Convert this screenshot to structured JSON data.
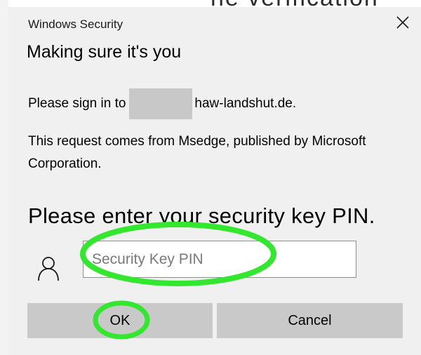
{
  "background": {
    "partial_text": "ne verification"
  },
  "dialog": {
    "label": "Windows Security",
    "title": "Making sure it's you",
    "signin_prefix": "Please sign in to",
    "signin_domain": "haw-landshut.de.",
    "request_text": "This request comes from Msedge, published by Microsoft Corporation.",
    "pin_prompt": "Please enter your security key PIN.",
    "pin_input": {
      "placeholder": "Security Key PIN",
      "value": ""
    },
    "ok_label": "OK",
    "cancel_label": "Cancel",
    "close_icon": "close-icon",
    "user_icon": "user-icon"
  },
  "annotations": {
    "color": "#33e62e",
    "targets": [
      "pin-input",
      "ok-button"
    ]
  }
}
